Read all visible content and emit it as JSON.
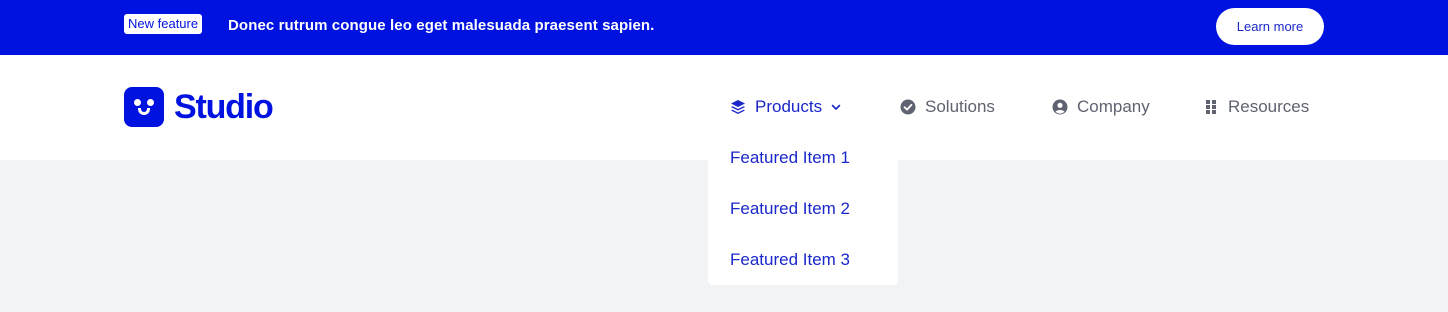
{
  "banner": {
    "badge": "New feature",
    "text": "Donec rutrum congue leo eget malesuada praesent sapien.",
    "cta": "Learn more"
  },
  "logo": {
    "text": "Studio"
  },
  "nav": {
    "products": "Products",
    "solutions": "Solutions",
    "company": "Company",
    "resources": "Resources"
  },
  "dropdown": {
    "items": [
      "Featured Item 1",
      "Featured Item 2",
      "Featured Item 3"
    ]
  },
  "colors": {
    "brand": "#0012e0",
    "link": "#1a27c9",
    "muted": "#5f6270",
    "background": "#f2f3f5"
  }
}
